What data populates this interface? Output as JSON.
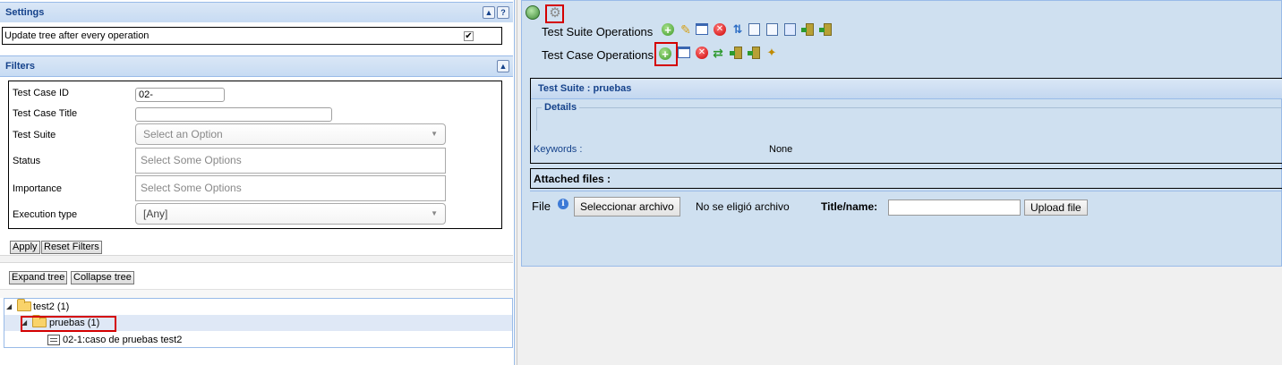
{
  "settings": {
    "title": "Settings",
    "update_tree_label": "Update tree after every operation",
    "update_tree_checked": true
  },
  "filters": {
    "title": "Filters",
    "test_case_id": {
      "label": "Test Case ID",
      "value": "02-"
    },
    "test_case_title": {
      "label": "Test Case Title",
      "value": ""
    },
    "test_suite": {
      "label": "Test Suite",
      "placeholder": "Select an Option"
    },
    "status": {
      "label": "Status",
      "placeholder": "Select Some Options"
    },
    "importance": {
      "label": "Importance",
      "placeholder": "Select Some Options"
    },
    "execution_type": {
      "label": "Execution type",
      "value": "[Any]"
    },
    "apply_label": "Apply",
    "reset_label": "Reset Filters"
  },
  "tree": {
    "expand_label": "Expand tree",
    "collapse_label": "Collapse tree",
    "nodes": [
      {
        "label": "test2 (1)"
      },
      {
        "label": "pruebas (1)"
      },
      {
        "label": "02-1:caso de pruebas test2"
      }
    ]
  },
  "right": {
    "suite_ops_label": "Test Suite Operations",
    "case_ops_label": "Test Case Operations",
    "suite_header": "Test Suite : pruebas",
    "details_legend": "Details",
    "keywords_label": "Keywords :",
    "keywords_value": "None",
    "attached_files_label": "Attached files :",
    "file_label": "File",
    "select_file_label": "Seleccionar archivo",
    "no_file_label": "No se eligió archivo",
    "title_name_label": "Title/name:",
    "title_name_value": "",
    "upload_label": "Upload file"
  },
  "colors": {
    "header_text": "#15428b",
    "highlight": "#d40000",
    "panel_bg": "#cfe0f0"
  }
}
